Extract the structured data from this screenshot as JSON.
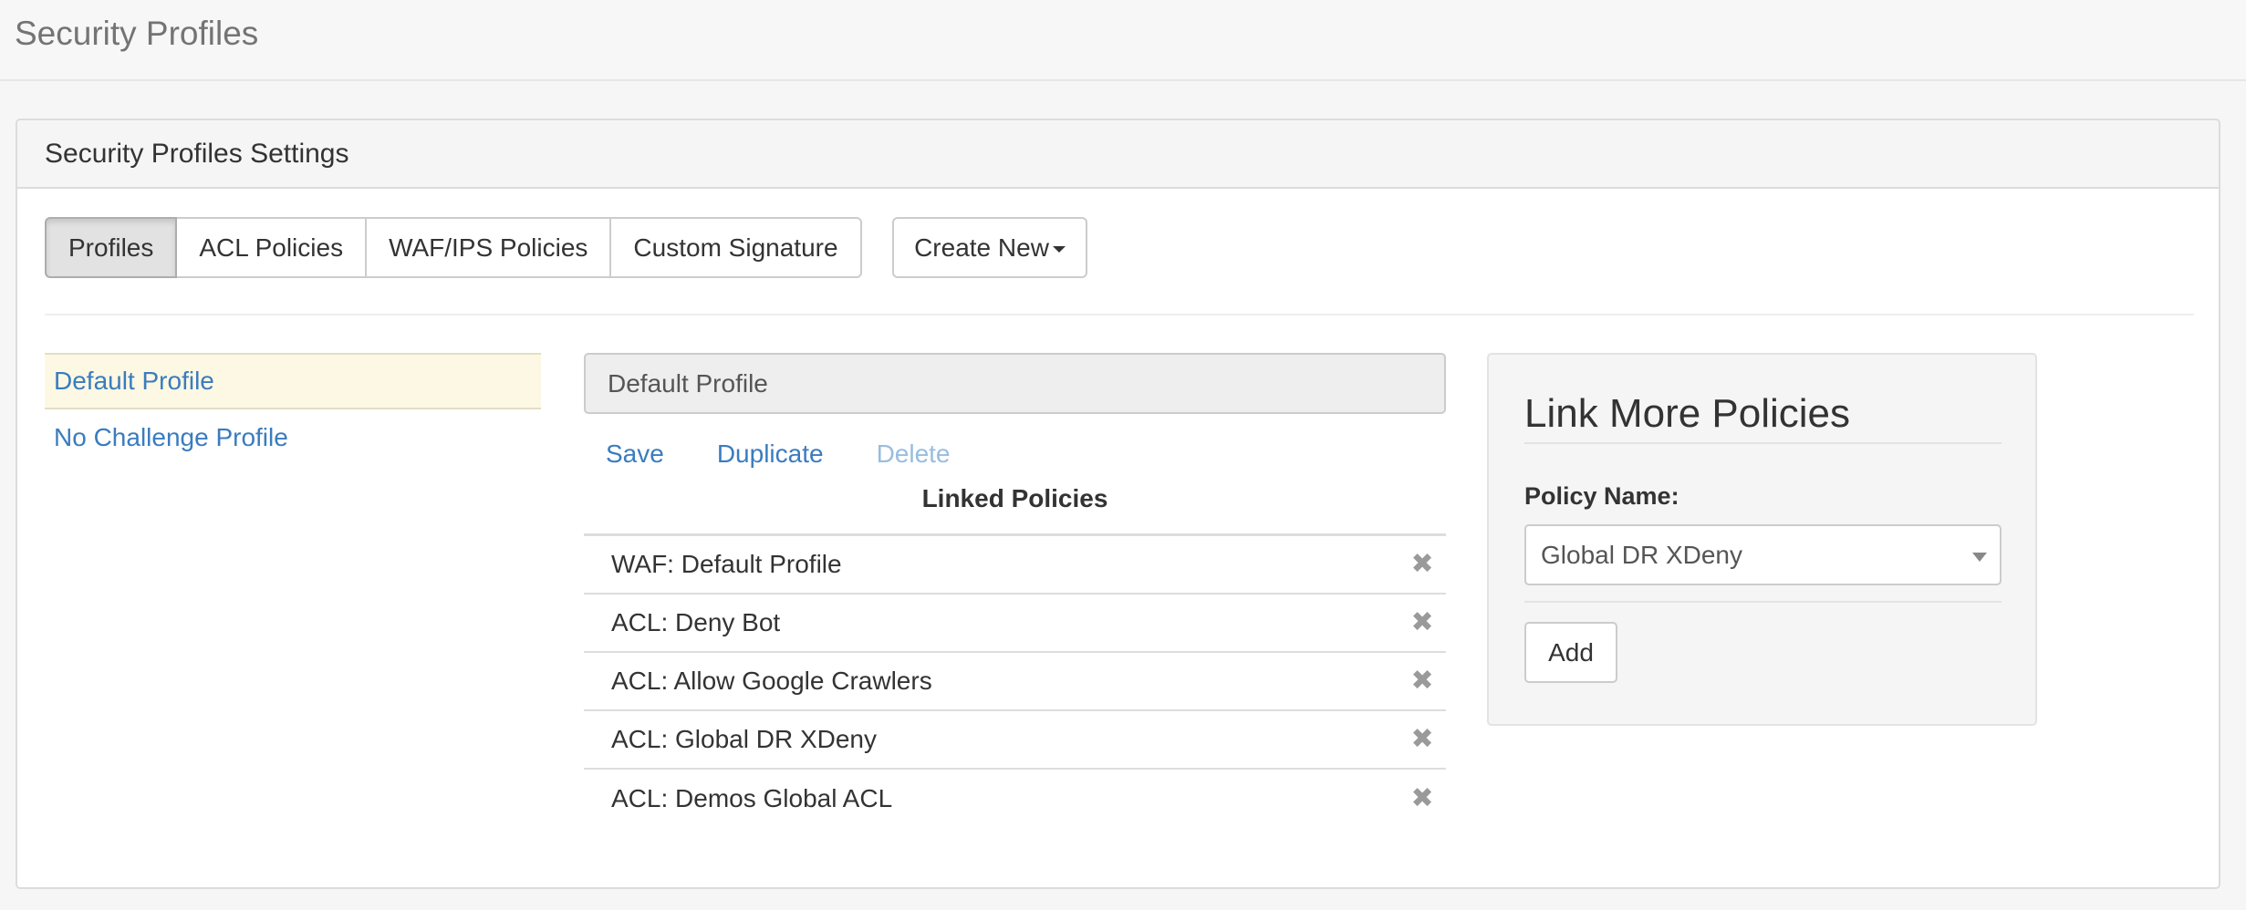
{
  "page": {
    "title": "Security Profiles"
  },
  "panel": {
    "title": "Security Profiles Settings"
  },
  "tabs": [
    {
      "label": "Profiles",
      "active": true
    },
    {
      "label": "ACL Policies",
      "active": false
    },
    {
      "label": "WAF/IPS Policies",
      "active": false
    },
    {
      "label": "Custom Signature",
      "active": false
    }
  ],
  "create_new": {
    "label": "Create New"
  },
  "profiles": [
    {
      "label": "Default Profile",
      "selected": true
    },
    {
      "label": "No Challenge Profile",
      "selected": false
    }
  ],
  "editor": {
    "profile_name": "Default Profile",
    "actions": {
      "save": "Save",
      "duplicate": "Duplicate",
      "delete": "Delete"
    },
    "linked_title": "Linked Policies",
    "linked_policies": [
      "WAF: Default Profile",
      "ACL: Deny Bot",
      "ACL: Allow Google Crawlers",
      "ACL: Global DR XDeny",
      "ACL: Demos Global ACL"
    ],
    "remove_glyph": "✖"
  },
  "link_more": {
    "title": "Link More Policies",
    "field_label": "Policy Name:",
    "selected_policy": "Global DR XDeny",
    "add_label": "Add"
  },
  "colors": {
    "link": "#3a7cbf",
    "active_row_bg": "#fcf8e3",
    "muted_link": "#98bde0"
  },
  "icons": {
    "remove": "close-icon",
    "dropdown": "chevron-down-icon"
  }
}
